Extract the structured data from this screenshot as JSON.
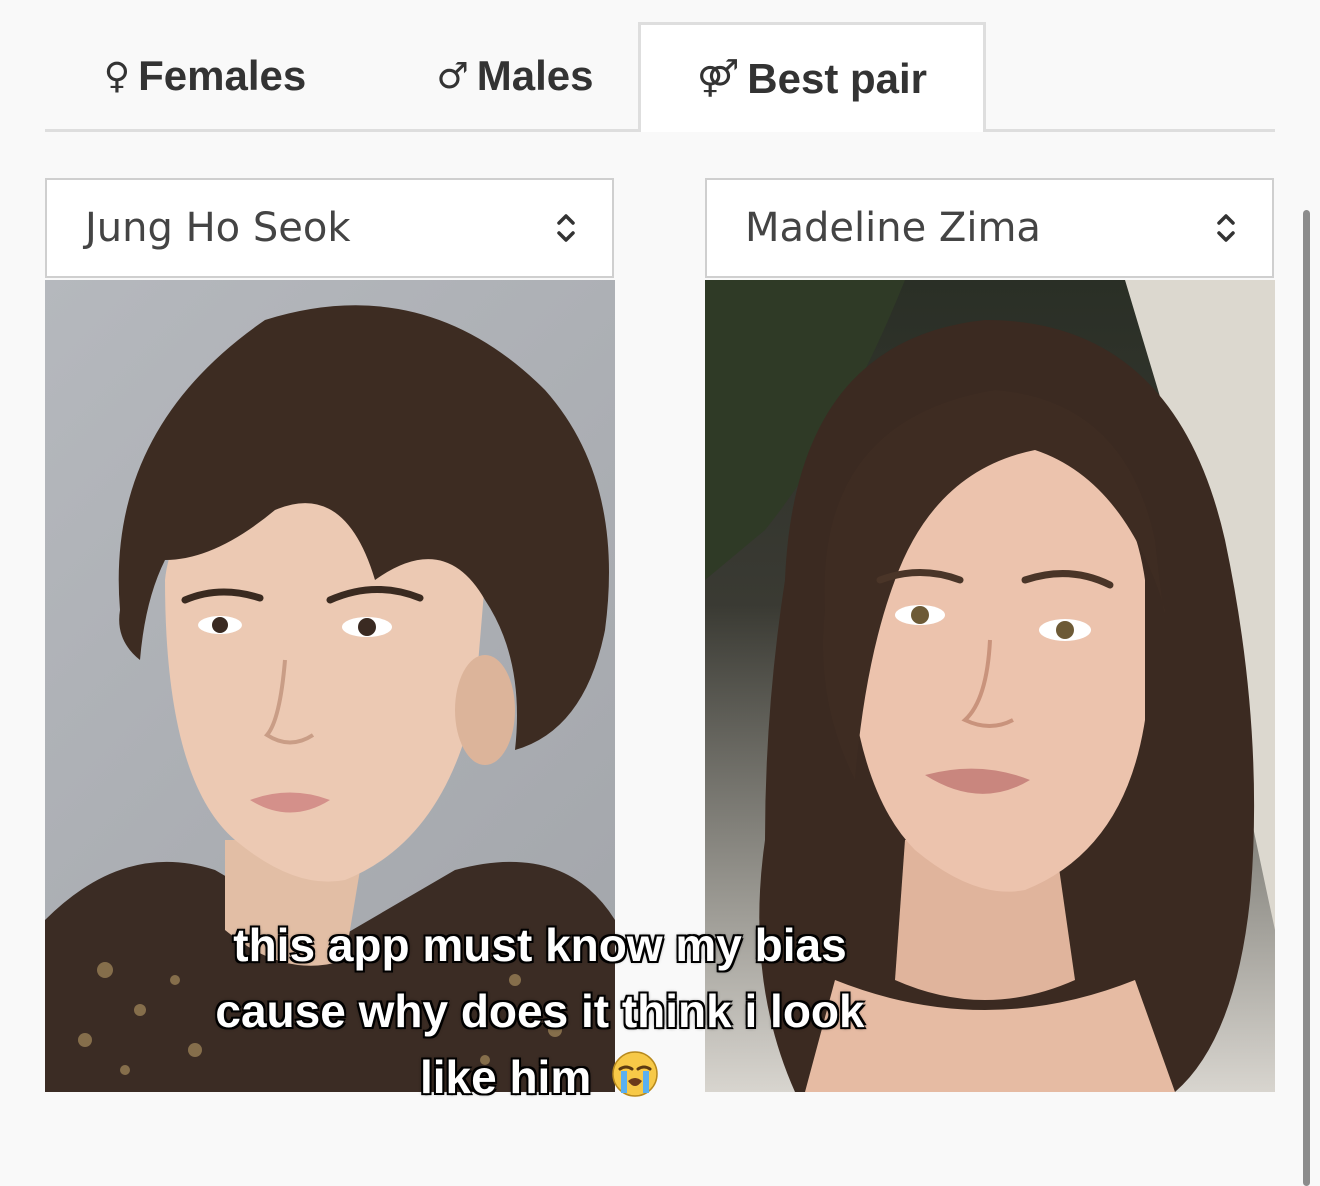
{
  "tabs": [
    {
      "glyph": "♀",
      "label": "Females",
      "active": false
    },
    {
      "glyph": "♂",
      "label": "Males",
      "active": false
    },
    {
      "glyph": "⚤",
      "label": "Best pair",
      "active": true
    }
  ],
  "selects": {
    "left": {
      "value": "Jung Ho Seok"
    },
    "right": {
      "value": "Madeline Zima"
    }
  },
  "caption": {
    "line1": "this app must know my bias",
    "line2": "cause why does it think i look",
    "line3": "like him",
    "emoji": "loudly-crying-face"
  },
  "colors": {
    "active_tab_bg": "#ffffff",
    "tab_border": "#dedede",
    "page_bg": "#f9f9f9"
  }
}
